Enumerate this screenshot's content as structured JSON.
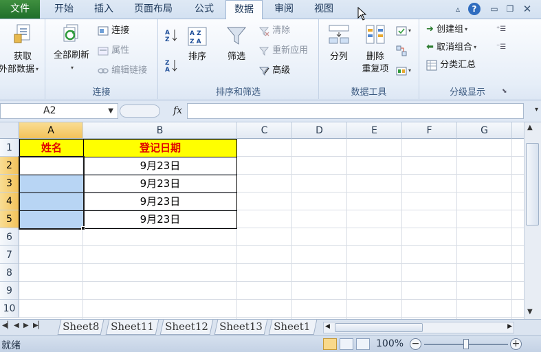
{
  "ribbon_tabs": {
    "file": "文件",
    "home": "开始",
    "insert": "插入",
    "page_layout": "页面布局",
    "formulas": "公式",
    "data": "数据",
    "review": "审阅",
    "view": "视图"
  },
  "groups": {
    "get_external": {
      "label1": "获取",
      "label2": "外部数据"
    },
    "connections": {
      "refresh_all": "全部刷新",
      "connections": "连接",
      "properties": "属性",
      "edit_links": "编辑链接",
      "label": "连接"
    },
    "sort_filter": {
      "sort": "排序",
      "filter": "筛选",
      "clear": "清除",
      "reapply": "重新应用",
      "advanced": "高级",
      "label": "排序和筛选"
    },
    "data_tools": {
      "text_to_columns": "分列",
      "remove_dup1": "删除",
      "remove_dup2": "重复项",
      "label": "数据工具"
    },
    "outline": {
      "group": "创建组",
      "ungroup": "取消组合",
      "subtotal": "分类汇总",
      "label": "分级显示"
    }
  },
  "formula_bar": {
    "name_box": "A2",
    "fx": "fx",
    "formula": ""
  },
  "grid": {
    "columns": [
      "A",
      "B",
      "C",
      "D",
      "E",
      "F",
      "G"
    ],
    "rows": [
      "1",
      "2",
      "3",
      "4",
      "5",
      "6",
      "7",
      "8",
      "9",
      "10"
    ],
    "header_row": [
      "姓名",
      "登记日期"
    ],
    "data_rows": [
      [
        "",
        "9月23日"
      ],
      [
        "",
        "9月23日"
      ],
      [
        "",
        "9月23日"
      ],
      [
        "",
        "9月23日"
      ]
    ]
  },
  "sheet_tabs": [
    "Sheet8",
    "Sheet11",
    "Sheet12",
    "Sheet13",
    "Sheet1"
  ],
  "status_bar": {
    "status": "就绪",
    "zoom": "100%"
  },
  "colors": {
    "header_fill": "#ffff00",
    "header_text": "#e00000",
    "selection_fill": "#b8d5f4",
    "file_tab": "#2f7d32"
  }
}
